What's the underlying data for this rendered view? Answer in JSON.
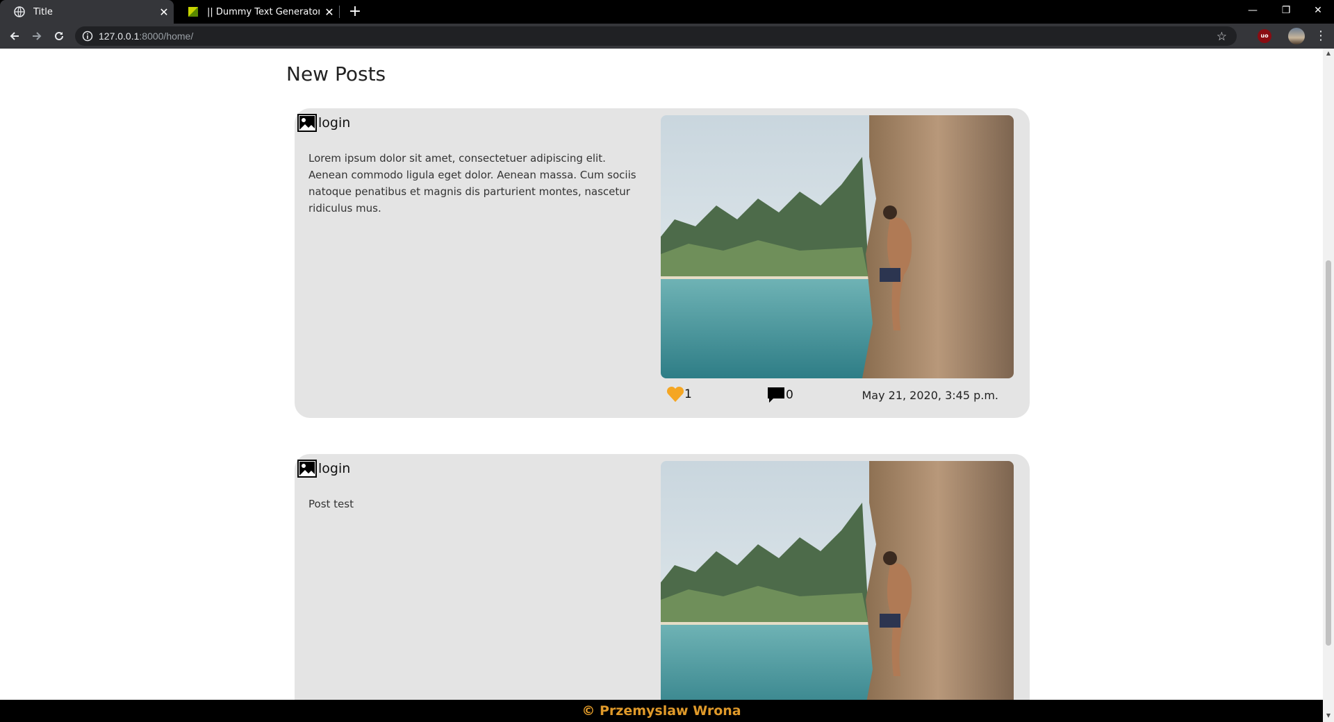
{
  "browser": {
    "tabs": [
      {
        "title": "Title",
        "active": true
      },
      {
        "title": "|| Dummy Text Generator | Lorem",
        "active": false
      }
    ],
    "url_host": "127.0.0.1",
    "url_rest": ":8000/home/",
    "extension_label": "uo"
  },
  "page": {
    "section_title": "New Posts",
    "posts": [
      {
        "author": "login",
        "body": "Lorem ipsum dolor sit amet, consectetuer adipiscing elit. Aenean commodo ligula eget dolor. Aenean massa. Cum sociis natoque penatibus et magnis dis parturient montes, nascetur ridiculus mus.",
        "likes": "1",
        "comments": "0",
        "date": "May 21, 2020, 3:45 p.m.",
        "image": "rock-climber-over-sea-photo"
      },
      {
        "author": "login",
        "body": "Post test",
        "image": "rock-climber-over-sea-photo"
      }
    ],
    "footer": "© Przemyslaw Wrona"
  },
  "colors": {
    "accent": "#e09a2a",
    "heart": "#f5a623",
    "card_bg": "#e4e4e4"
  }
}
